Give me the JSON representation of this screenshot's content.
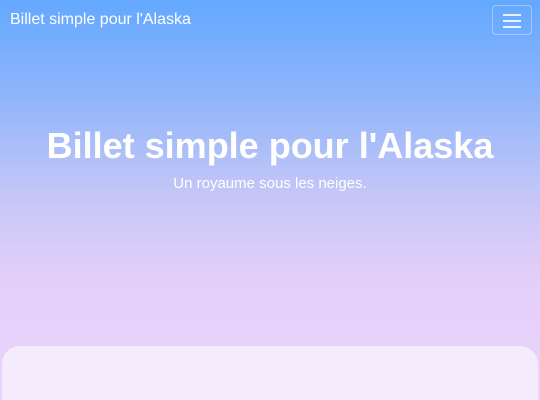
{
  "navbar": {
    "brand": "Billet simple pour l'Alaska",
    "toggle_icon": "hamburger-menu-icon"
  },
  "hero": {
    "title": "Billet simple pour l'Alaska",
    "subtitle": "Un royaume sous les neiges."
  },
  "colors": {
    "gradient_top": "#63a8ff",
    "gradient_bottom": "#ead4fb",
    "text": "#ffffff",
    "card": "#f4ebfc"
  }
}
